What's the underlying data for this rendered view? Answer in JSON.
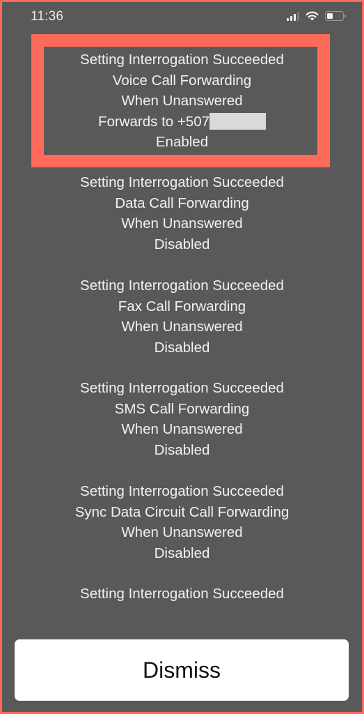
{
  "status_bar": {
    "time": "11:36",
    "signal_bars_active": 3,
    "signal_bars_total": 4,
    "wifi": "wifi-icon",
    "battery_level_fraction": 0.4
  },
  "highlight_color": "#ff6b5a",
  "messages": [
    {
      "lines": [
        "Setting Interrogation Succeeded",
        "Voice Call Forwarding",
        "When Unanswered"
      ],
      "forward_prefix": "Forwards to +507",
      "forward_redacted": true,
      "status": "Enabled",
      "highlighted": true
    },
    {
      "lines": [
        "Setting Interrogation Succeeded",
        "Data Call Forwarding",
        "When Unanswered"
      ],
      "status": "Disabled"
    },
    {
      "lines": [
        "Setting Interrogation Succeeded",
        "Fax Call Forwarding",
        "When Unanswered"
      ],
      "status": "Disabled"
    },
    {
      "lines": [
        "Setting Interrogation Succeeded",
        "SMS Call Forwarding",
        "When Unanswered"
      ],
      "status": "Disabled"
    },
    {
      "lines": [
        "Setting Interrogation Succeeded",
        "Sync Data Circuit Call Forwarding",
        "When Unanswered"
      ],
      "status": "Disabled"
    },
    {
      "lines": [
        "Setting Interrogation Succeeded"
      ]
    }
  ],
  "dismiss_label": "Dismiss"
}
